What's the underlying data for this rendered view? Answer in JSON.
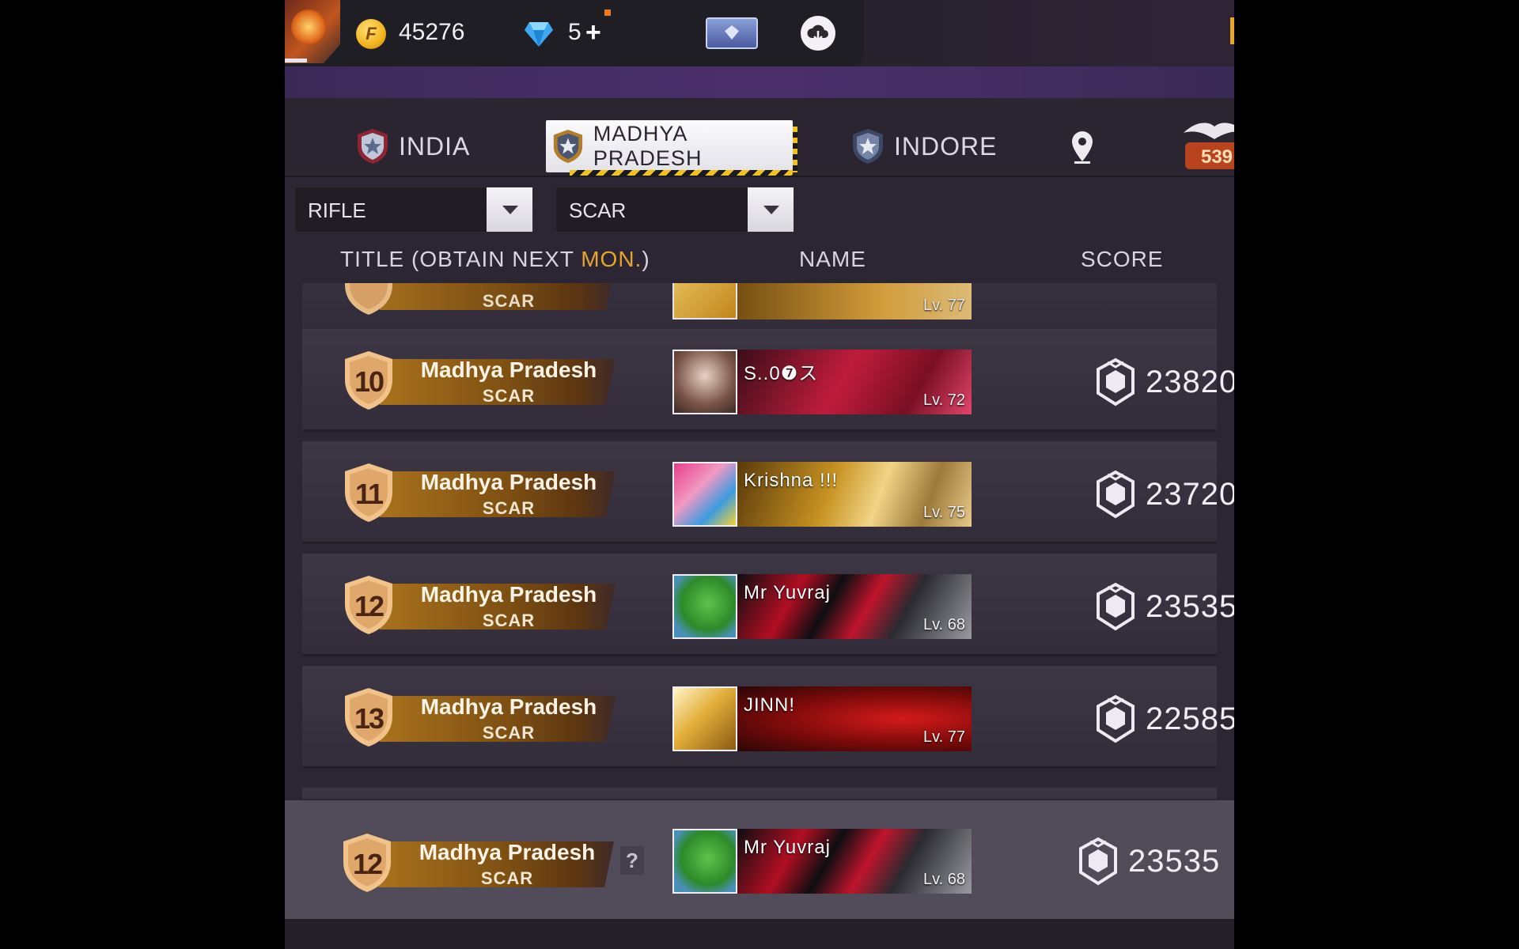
{
  "header": {
    "coins": "45276",
    "diamonds": "5",
    "add_symbol": "+",
    "coin_symbol": "F",
    "icons": [
      "avatar-frame",
      "coin-icon",
      "diamond-icon",
      "membership-card-icon",
      "cloud-download-icon"
    ]
  },
  "tabs": [
    {
      "label": "INDIA",
      "active": false
    },
    {
      "label": "MADHYA PRADESH",
      "active": true
    },
    {
      "label": "INDORE",
      "active": false
    }
  ],
  "rank_badge_number": "539",
  "filters": {
    "weapon_type": "RIFLE",
    "weapon": "SCAR"
  },
  "columns": {
    "title_prefix": "TITLE (OBTAIN NEXT ",
    "title_highlight": "MON.",
    "title_suffix": ")",
    "name": "NAME",
    "score": "SCORE"
  },
  "partial_row": {
    "weapon": "SCAR",
    "level": "Lv. 77"
  },
  "rows": [
    {
      "rank": "10",
      "region": "Madhya Pradesh",
      "weapon": "SCAR",
      "name": "S..0❼ス",
      "level": "Lv. 72",
      "score": "23820"
    },
    {
      "rank": "11",
      "region": "Madhya Pradesh",
      "weapon": "SCAR",
      "name": "Krishna   !!!",
      "level": "Lv. 75",
      "score": "23720"
    },
    {
      "rank": "12",
      "region": "Madhya Pradesh",
      "weapon": "SCAR",
      "name": "Mr   Yuvraj",
      "level": "Lv. 68",
      "score": "23535"
    },
    {
      "rank": "13",
      "region": "Madhya Pradesh",
      "weapon": "SCAR",
      "name": "JINN!",
      "level": "Lv. 77",
      "score": "22585"
    }
  ],
  "my_row": {
    "rank": "12",
    "region": "Madhya Pradesh",
    "weapon": "SCAR",
    "name": "Mr   Yuvraj",
    "level": "Lv. 68",
    "score": "23535",
    "help": "?"
  },
  "colors": {
    "accent_gold": "#e6a52a",
    "hazard_yellow": "#f2c11c",
    "panel": "#3a3442"
  }
}
